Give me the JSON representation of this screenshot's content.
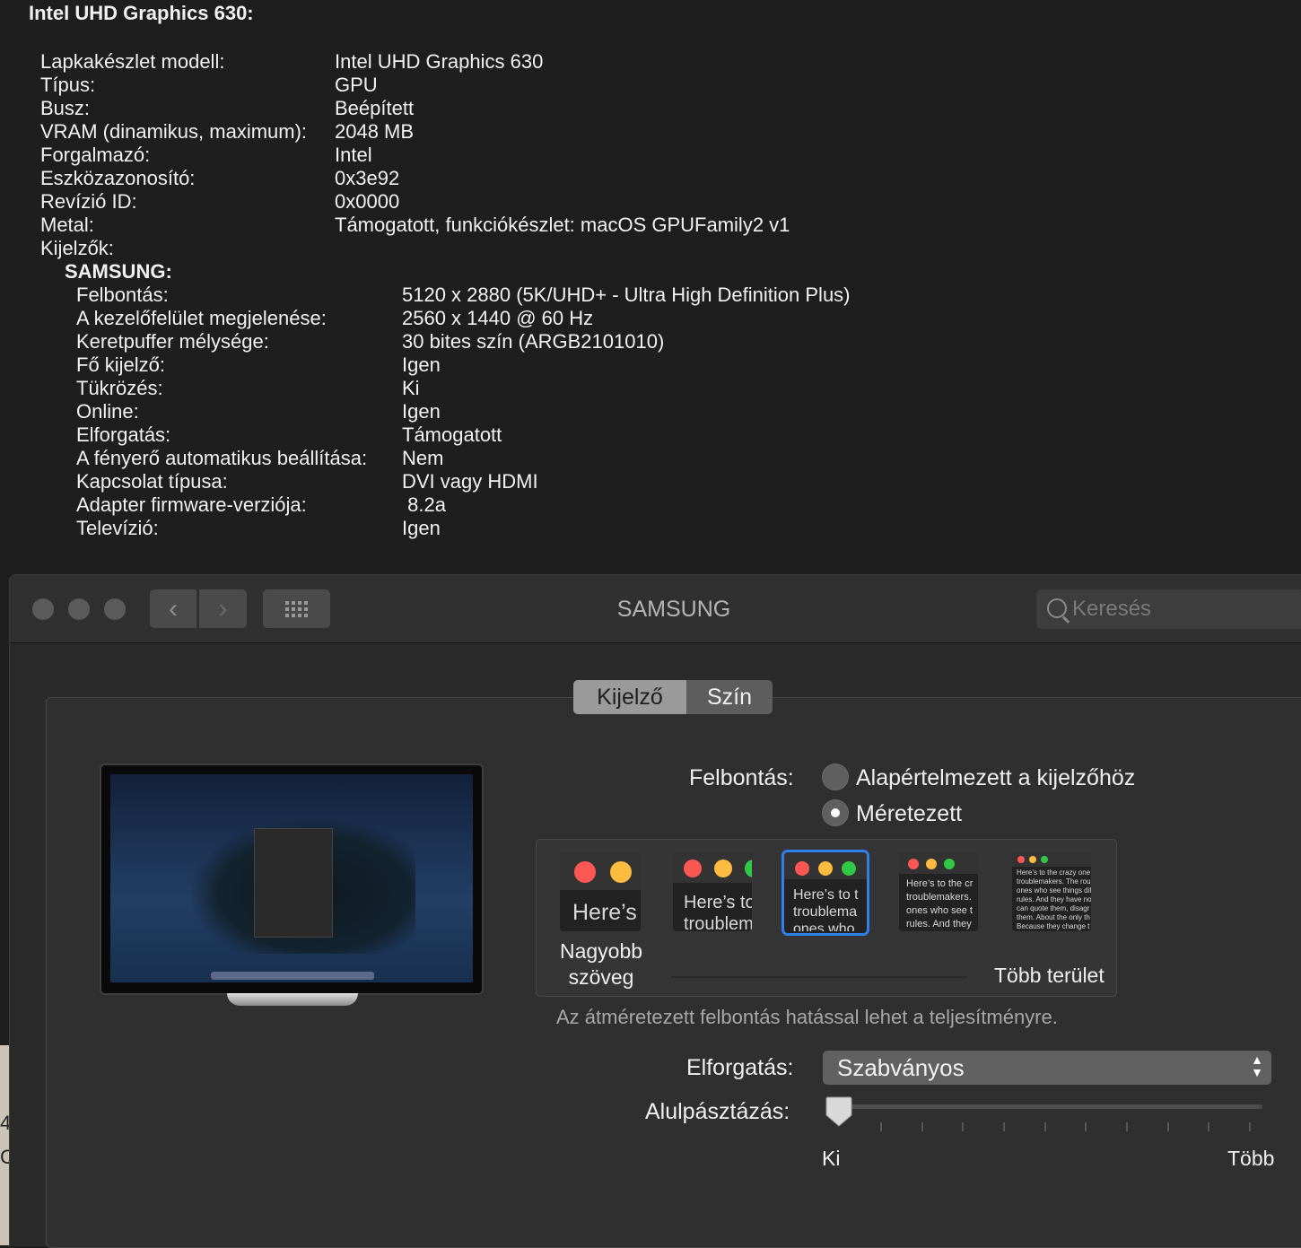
{
  "info": {
    "title": "Intel UHD Graphics 630:",
    "rows": [
      {
        "label": "Lapkakészlet modell:",
        "value": "Intel UHD Graphics 630"
      },
      {
        "label": "Típus:",
        "value": "GPU"
      },
      {
        "label": "Busz:",
        "value": "Beépített"
      },
      {
        "label": "VRAM (dinamikus, maximum):",
        "value": "2048 MB"
      },
      {
        "label": "Forgalmazó:",
        "value": "Intel"
      },
      {
        "label": "Eszközazonosító:",
        "value": "0x3e92"
      },
      {
        "label": "Revízió ID:",
        "value": "0x0000"
      },
      {
        "label": "Metal:",
        "value": "Támogatott, funkciókészlet: macOS GPUFamily2 v1"
      },
      {
        "label": "Kijelzők:",
        "value": ""
      }
    ],
    "display_name": "SAMSUNG:",
    "display_rows": [
      {
        "label": "Felbontás:",
        "value": "5120 x 2880 (5K/UHD+ - Ultra High Definition Plus)"
      },
      {
        "label": "A kezelőfelület megjelenése:",
        "value": "2560 x 1440 @ 60 Hz"
      },
      {
        "label": "Keretpuffer mélysége:",
        "value": "30 bites szín (ARGB2101010)"
      },
      {
        "label": "Fő kijelző:",
        "value": "Igen"
      },
      {
        "label": "Tükrözés:",
        "value": "Ki"
      },
      {
        "label": "Online:",
        "value": "Igen"
      },
      {
        "label": "Elforgatás:",
        "value": "Támogatott"
      },
      {
        "label": "A fényerő automatikus beállítása:",
        "value": "Nem"
      },
      {
        "label": "Kapcsolat típusa:",
        "value": "DVI vagy HDMI"
      },
      {
        "label": "Adapter firmware-verziója:",
        "value": " 8.2a"
      },
      {
        "label": "Televízió:",
        "value": "Igen"
      }
    ]
  },
  "background_window_fragment": [
    "4",
    "C"
  ],
  "window": {
    "title": "SAMSUNG",
    "search_placeholder": "Keresés",
    "tabs": [
      {
        "label": "Kijelző",
        "selected": true
      },
      {
        "label": "Szín",
        "selected": false
      }
    ],
    "resolution": {
      "label": "Felbontás:",
      "options": [
        {
          "label": "Alapértelmezett a kijelzőhöz",
          "selected": false
        },
        {
          "label": "Méretezett",
          "selected": true
        }
      ]
    },
    "scaling": {
      "thumb_texts": [
        "Here’s",
        "Here’s to\ntroublem",
        "Here’s to t\ntroublema\nones who",
        "Here’s to the cr\ntroublemakers.\nones who see t\nrules. And they",
        "Here’s to the crazy one\ntroublemakers. The rou\nones who see things dif\nrules. And they have no\ncan quote them, disagr\nthem. About the only th\nBecause they change t"
      ],
      "selected_index": 2,
      "left_label": "Nagyobb\nszöveg",
      "right_label": "Több terület"
    },
    "note": "Az átméretezett felbontás hatással lehet a teljesítményre.",
    "rotation": {
      "label": "Elforgatás:",
      "value": "Szabványos"
    },
    "underscan": {
      "label": "Alulpásztázás:",
      "min_label": "Ki",
      "max_label": "Több",
      "value": 0
    }
  },
  "colors": {
    "traffic_red": "#fc5753",
    "traffic_yellow": "#fdbc40",
    "traffic_green": "#33c748",
    "accent": "#2f80ed"
  }
}
